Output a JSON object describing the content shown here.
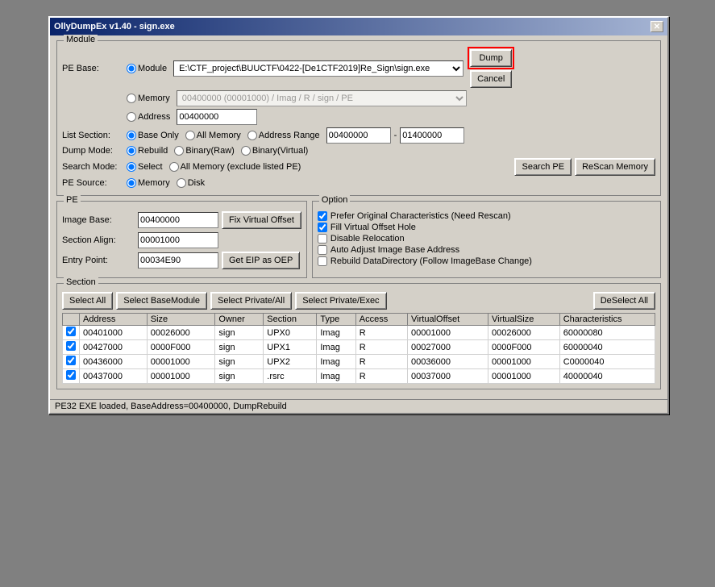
{
  "window": {
    "title": "OllyDumpEx v1.40 - sign.exe",
    "close_label": "✕"
  },
  "module_group": {
    "title": "Module",
    "pe_base_label": "PE Base:",
    "module_radio": "Module",
    "memory_radio": "Memory",
    "address_radio": "Address",
    "module_path": "E:\\CTF_project\\BUUCTF\\0422-[De1CTF2019]Re_Sign\\sign.exe",
    "memory_value": "00400000 (00001000) / Imag / R     / sign / PE",
    "address_value": "00400000"
  },
  "list_section": {
    "label": "List Section:",
    "base_only": "Base Only",
    "all_memory": "All Memory",
    "address_range": "Address Range",
    "range_start": "00400000",
    "range_end": "01400000"
  },
  "dump_mode": {
    "label": "Dump Mode:",
    "rebuild": "Rebuild",
    "binary_raw": "Binary(Raw)",
    "binary_virtual": "Binary(Virtual)"
  },
  "search_mode": {
    "label": "Search Mode:",
    "select": "Select",
    "all_memory_excl": "All Memory (exclude listed PE)"
  },
  "pe_source": {
    "label": "PE Source:",
    "memory": "Memory",
    "disk": "Disk"
  },
  "buttons": {
    "search_pe": "Search PE",
    "rescan_memory": "ReScan Memory",
    "dump": "Dump",
    "cancel": "Cancel"
  },
  "pe_group": {
    "title": "PE",
    "image_base_label": "Image Base:",
    "image_base_value": "00400000",
    "fix_virtual_offset": "Fix Virtual Offset",
    "section_align_label": "Section Align:",
    "section_align_value": "00001000",
    "entry_point_label": "Entry Point:",
    "entry_point_value": "00034E90",
    "get_eip": "Get EIP as OEP"
  },
  "option_group": {
    "title": "Option",
    "options": [
      {
        "label": "Prefer Original Characteristics (Need Rescan)",
        "checked": true
      },
      {
        "label": "Fill Virtual Offset Hole",
        "checked": true
      },
      {
        "label": "Disable Relocation",
        "checked": false
      },
      {
        "label": "Auto Adjust Image Base Address",
        "checked": false
      },
      {
        "label": "Rebuild DataDirectory (Follow ImageBase Change)",
        "checked": false
      }
    ]
  },
  "section_group": {
    "title": "Section",
    "buttons": {
      "select_all": "Select All",
      "select_basemodule": "Select BaseModule",
      "select_private_all": "Select Private/All",
      "select_private_exec": "Select Private/Exec",
      "deselect_all": "DeSelect All"
    },
    "table": {
      "headers": [
        "",
        "Address",
        "Size",
        "Owner",
        "Section",
        "Type",
        "Access",
        "VirtualOffset",
        "VirtualSize",
        "Characteristics"
      ],
      "rows": [
        {
          "checked": true,
          "address": "00401000",
          "size": "00026000",
          "owner": "sign",
          "section": "UPX0",
          "type": "Imag",
          "access": "R",
          "virtual_offset": "00001000",
          "virtual_size": "00026000",
          "characteristics": "60000080"
        },
        {
          "checked": true,
          "address": "00427000",
          "size": "0000F000",
          "owner": "sign",
          "section": "UPX1",
          "type": "Imag",
          "access": "R",
          "virtual_offset": "00027000",
          "virtual_size": "0000F000",
          "characteristics": "60000040"
        },
        {
          "checked": true,
          "address": "00436000",
          "size": "00001000",
          "owner": "sign",
          "section": "UPX2",
          "type": "Imag",
          "access": "R",
          "virtual_offset": "00036000",
          "virtual_size": "00001000",
          "characteristics": "C0000040"
        },
        {
          "checked": true,
          "address": "00437000",
          "size": "00001000",
          "owner": "sign",
          "section": ".rsrc",
          "type": "Imag",
          "access": "R",
          "virtual_offset": "00037000",
          "virtual_size": "00001000",
          "characteristics": "40000040"
        }
      ]
    }
  },
  "status_bar": {
    "text": "PE32 EXE loaded, BaseAddress=00400000, DumpRebuild"
  }
}
